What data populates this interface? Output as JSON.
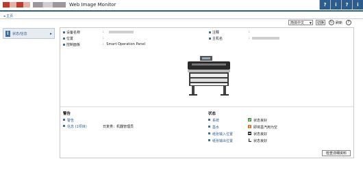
{
  "header": {
    "app_title": "Web Image Monitor",
    "icons": [
      "?",
      "i",
      "?",
      "i"
    ]
  },
  "nav": {
    "home_link": "◂ 主页"
  },
  "sidebar": {
    "items": [
      {
        "label": "状态/信息",
        "chevron": "▸"
      }
    ]
  },
  "toolbar": {
    "language_value": "简体中文",
    "switch_label": "切换",
    "refresh_label": "刷新",
    "help_glyph": "?"
  },
  "device_info": {
    "left": [
      {
        "label": "设备名称",
        "value": ""
      },
      {
        "label": "位置",
        "value": ""
      },
      {
        "label": "控制面板",
        "value": "Smart Operation Panel"
      }
    ],
    "right": [
      {
        "label": "注释",
        "value": ""
      },
      {
        "label": "主机名",
        "value": ""
      }
    ],
    "colon": ":"
  },
  "alerts": {
    "title": "警告",
    "items": [
      {
        "link": "警告",
        "text": ""
      },
      {
        "link": "信息 (1项目)",
        "text": "日复类：机器管理员"
      }
    ]
  },
  "status": {
    "title": "状态",
    "items": [
      {
        "link": "系统",
        "text": "状态良好",
        "icon": "ok-icon"
      },
      {
        "link": "墨水",
        "text": "即将墨汽用为空",
        "icon": "warning-icon"
      },
      {
        "link": "纸张输入位置",
        "text": "状态良好",
        "icon": "tray-icon"
      },
      {
        "link": "纸张输出位置",
        "text": "状态良好",
        "icon": "output-icon"
      }
    ]
  },
  "detail_button": {
    "label": "检查详细资料"
  },
  "colors": {
    "accent": "#2b5d8f",
    "brand_red": "#c0392b",
    "ok_green": "#3a9a3a",
    "warn_orange": "#e07a20"
  }
}
